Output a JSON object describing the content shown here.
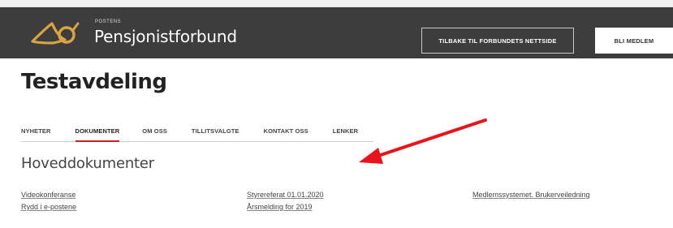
{
  "header": {
    "brand_small": "POSTENS",
    "brand_name": "Pensjonistforbund",
    "back_button": "TILBAKE TIL FORBUNDETS NETTSIDE",
    "member_button": "BLI MEDLEM"
  },
  "page": {
    "title": "Testavdeling"
  },
  "tabs": [
    {
      "label": "NYHETER",
      "active": false
    },
    {
      "label": "DOKUMENTER",
      "active": true
    },
    {
      "label": "OM OSS",
      "active": false
    },
    {
      "label": "TILLITSVALGTE",
      "active": false
    },
    {
      "label": "KONTAKT OSS",
      "active": false
    },
    {
      "label": "LENKER",
      "active": false
    }
  ],
  "section": {
    "heading": "Hoveddokumenter"
  },
  "documents": [
    {
      "label": "Videokonferanse"
    },
    {
      "label": "Rydd i e-postene"
    },
    {
      "label": "Styrereferat 01.01.2020"
    },
    {
      "label": "Årsmelding for 2019"
    },
    {
      "label": "Medlemssystemet. Brukerveiledning"
    }
  ],
  "colors": {
    "header_bg": "#3d3d3d",
    "logo_gold": "#d9a441",
    "active_tab": "#c61f2e",
    "annotation_arrow": "#e8131b"
  },
  "icons": {
    "logo": "post-horn-icon",
    "annotation": "red-arrow-icon"
  }
}
